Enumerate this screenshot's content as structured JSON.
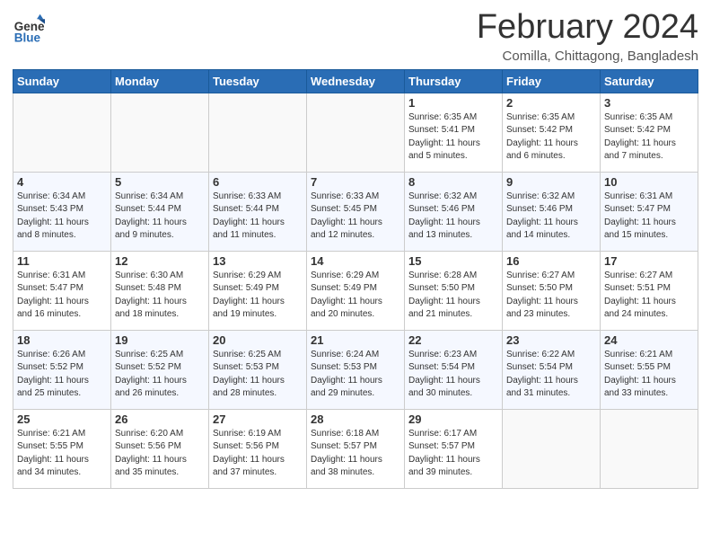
{
  "header": {
    "logo_general": "General",
    "logo_blue": "Blue",
    "month_title": "February 2024",
    "subtitle": "Comilla, Chittagong, Bangladesh"
  },
  "weekdays": [
    "Sunday",
    "Monday",
    "Tuesday",
    "Wednesday",
    "Thursday",
    "Friday",
    "Saturday"
  ],
  "weeks": [
    [
      {
        "day": "",
        "info": ""
      },
      {
        "day": "",
        "info": ""
      },
      {
        "day": "",
        "info": ""
      },
      {
        "day": "",
        "info": ""
      },
      {
        "day": "1",
        "info": "Sunrise: 6:35 AM\nSunset: 5:41 PM\nDaylight: 11 hours\nand 5 minutes."
      },
      {
        "day": "2",
        "info": "Sunrise: 6:35 AM\nSunset: 5:42 PM\nDaylight: 11 hours\nand 6 minutes."
      },
      {
        "day": "3",
        "info": "Sunrise: 6:35 AM\nSunset: 5:42 PM\nDaylight: 11 hours\nand 7 minutes."
      }
    ],
    [
      {
        "day": "4",
        "info": "Sunrise: 6:34 AM\nSunset: 5:43 PM\nDaylight: 11 hours\nand 8 minutes."
      },
      {
        "day": "5",
        "info": "Sunrise: 6:34 AM\nSunset: 5:44 PM\nDaylight: 11 hours\nand 9 minutes."
      },
      {
        "day": "6",
        "info": "Sunrise: 6:33 AM\nSunset: 5:44 PM\nDaylight: 11 hours\nand 11 minutes."
      },
      {
        "day": "7",
        "info": "Sunrise: 6:33 AM\nSunset: 5:45 PM\nDaylight: 11 hours\nand 12 minutes."
      },
      {
        "day": "8",
        "info": "Sunrise: 6:32 AM\nSunset: 5:46 PM\nDaylight: 11 hours\nand 13 minutes."
      },
      {
        "day": "9",
        "info": "Sunrise: 6:32 AM\nSunset: 5:46 PM\nDaylight: 11 hours\nand 14 minutes."
      },
      {
        "day": "10",
        "info": "Sunrise: 6:31 AM\nSunset: 5:47 PM\nDaylight: 11 hours\nand 15 minutes."
      }
    ],
    [
      {
        "day": "11",
        "info": "Sunrise: 6:31 AM\nSunset: 5:47 PM\nDaylight: 11 hours\nand 16 minutes."
      },
      {
        "day": "12",
        "info": "Sunrise: 6:30 AM\nSunset: 5:48 PM\nDaylight: 11 hours\nand 18 minutes."
      },
      {
        "day": "13",
        "info": "Sunrise: 6:29 AM\nSunset: 5:49 PM\nDaylight: 11 hours\nand 19 minutes."
      },
      {
        "day": "14",
        "info": "Sunrise: 6:29 AM\nSunset: 5:49 PM\nDaylight: 11 hours\nand 20 minutes."
      },
      {
        "day": "15",
        "info": "Sunrise: 6:28 AM\nSunset: 5:50 PM\nDaylight: 11 hours\nand 21 minutes."
      },
      {
        "day": "16",
        "info": "Sunrise: 6:27 AM\nSunset: 5:50 PM\nDaylight: 11 hours\nand 23 minutes."
      },
      {
        "day": "17",
        "info": "Sunrise: 6:27 AM\nSunset: 5:51 PM\nDaylight: 11 hours\nand 24 minutes."
      }
    ],
    [
      {
        "day": "18",
        "info": "Sunrise: 6:26 AM\nSunset: 5:52 PM\nDaylight: 11 hours\nand 25 minutes."
      },
      {
        "day": "19",
        "info": "Sunrise: 6:25 AM\nSunset: 5:52 PM\nDaylight: 11 hours\nand 26 minutes."
      },
      {
        "day": "20",
        "info": "Sunrise: 6:25 AM\nSunset: 5:53 PM\nDaylight: 11 hours\nand 28 minutes."
      },
      {
        "day": "21",
        "info": "Sunrise: 6:24 AM\nSunset: 5:53 PM\nDaylight: 11 hours\nand 29 minutes."
      },
      {
        "day": "22",
        "info": "Sunrise: 6:23 AM\nSunset: 5:54 PM\nDaylight: 11 hours\nand 30 minutes."
      },
      {
        "day": "23",
        "info": "Sunrise: 6:22 AM\nSunset: 5:54 PM\nDaylight: 11 hours\nand 31 minutes."
      },
      {
        "day": "24",
        "info": "Sunrise: 6:21 AM\nSunset: 5:55 PM\nDaylight: 11 hours\nand 33 minutes."
      }
    ],
    [
      {
        "day": "25",
        "info": "Sunrise: 6:21 AM\nSunset: 5:55 PM\nDaylight: 11 hours\nand 34 minutes."
      },
      {
        "day": "26",
        "info": "Sunrise: 6:20 AM\nSunset: 5:56 PM\nDaylight: 11 hours\nand 35 minutes."
      },
      {
        "day": "27",
        "info": "Sunrise: 6:19 AM\nSunset: 5:56 PM\nDaylight: 11 hours\nand 37 minutes."
      },
      {
        "day": "28",
        "info": "Sunrise: 6:18 AM\nSunset: 5:57 PM\nDaylight: 11 hours\nand 38 minutes."
      },
      {
        "day": "29",
        "info": "Sunrise: 6:17 AM\nSunset: 5:57 PM\nDaylight: 11 hours\nand 39 minutes."
      },
      {
        "day": "",
        "info": ""
      },
      {
        "day": "",
        "info": ""
      }
    ]
  ]
}
